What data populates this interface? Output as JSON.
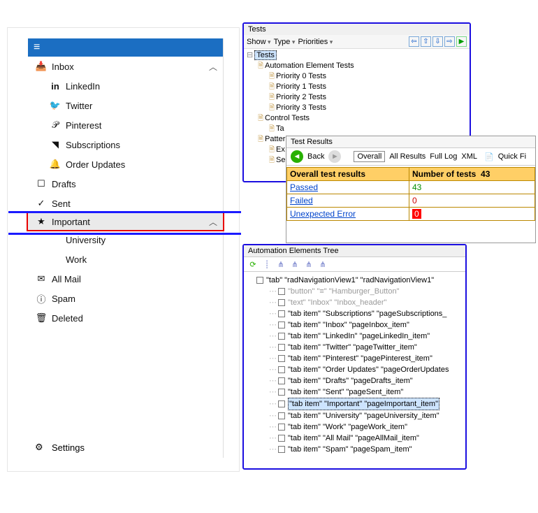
{
  "sidebar": {
    "items": [
      {
        "label": "Inbox",
        "icon": "📥",
        "expandable": true
      },
      {
        "label": "LinkedIn",
        "icon": "in",
        "sub": true
      },
      {
        "label": "Twitter",
        "icon": "🐦",
        "sub": true
      },
      {
        "label": "Pinterest",
        "icon": "𝒫",
        "sub": true
      },
      {
        "label": "Subscriptions",
        "icon": "◥",
        "sub": true
      },
      {
        "label": "Order Updates",
        "icon": "🔔",
        "sub": true
      },
      {
        "label": "Drafts",
        "icon": "☐"
      },
      {
        "label": "Sent",
        "icon": "✓"
      },
      {
        "label": "Important",
        "icon": "★",
        "expandable": true,
        "highlight": true
      },
      {
        "label": "University",
        "sub": true
      },
      {
        "label": "Work",
        "sub": true
      },
      {
        "label": "All Mail",
        "icon": "✉"
      },
      {
        "label": "Spam",
        "icon": "ⓘ"
      },
      {
        "label": "Deleted",
        "icon": "🗑"
      }
    ],
    "settings": "Settings"
  },
  "tests_panel": {
    "title": "Tests",
    "toolbar": {
      "show": "Show",
      "type": "Type",
      "priorities": "Priorities"
    },
    "tree": {
      "root": "Tests",
      "auto_elem": "Automation Element Tests",
      "p0": "Priority 0 Tests",
      "p1": "Priority 1 Tests",
      "p2": "Priority 2 Tests",
      "p3": "Priority 3 Tests",
      "control": "Control Tests",
      "ta": "Ta",
      "pattern": "Patter",
      "ex": "Ex",
      "se": "Se"
    }
  },
  "results_panel": {
    "title": "Test Results",
    "back": "Back",
    "tabs": {
      "overall": "Overall",
      "all": "All Results",
      "full": "Full Log",
      "xml": "XML",
      "quick": "Quick Fi"
    },
    "table": {
      "h1": "Overall test results",
      "h2": "Number of tests",
      "total": "43",
      "passed_label": "Passed",
      "passed_val": "43",
      "failed_label": "Failed",
      "failed_val": "0",
      "err_label": "Unexpected Error",
      "err_val": "0"
    }
  },
  "auto_panel": {
    "title": "Automation Elements Tree",
    "root": "\"tab\" \"radNavigationView1\" \"radNavigationView1\"",
    "rows": [
      {
        "t": "\"button\" \"≡\" \"Hamburger_Button\"",
        "dim": true
      },
      {
        "t": "\"text\" \"Inbox\" \"Inbox_header\"",
        "dim": true
      },
      {
        "t": "\"tab item\" \"Subscriptions\" \"pageSubscriptions_"
      },
      {
        "t": "\"tab item\" \"Inbox\" \"pageInbox_item\""
      },
      {
        "t": "\"tab item\" \"LinkedIn\" \"pageLinkedIn_item\""
      },
      {
        "t": "\"tab item\" \"Twitter\" \"pageTwitter_item\""
      },
      {
        "t": "\"tab item\" \"Pinterest\" \"pagePinterest_item\""
      },
      {
        "t": "\"tab item\" \"Order Updates\" \"pageOrderUpdates"
      },
      {
        "t": "\"tab item\" \"Drafts\" \"pageDrafts_item\""
      },
      {
        "t": "\"tab item\" \"Sent\" \"pageSent_item\""
      },
      {
        "t": "\"tab item\" \"Important\" \"pageImportant_item\"",
        "sel": true
      },
      {
        "t": "\"tab item\" \"University\" \"pageUniversity_item\""
      },
      {
        "t": "\"tab item\" \"Work\" \"pageWork_item\""
      },
      {
        "t": "\"tab item\" \"All Mail\" \"pageAllMail_item\""
      },
      {
        "t": "\"tab item\" \"Spam\" \"pageSpam_item\""
      }
    ]
  }
}
